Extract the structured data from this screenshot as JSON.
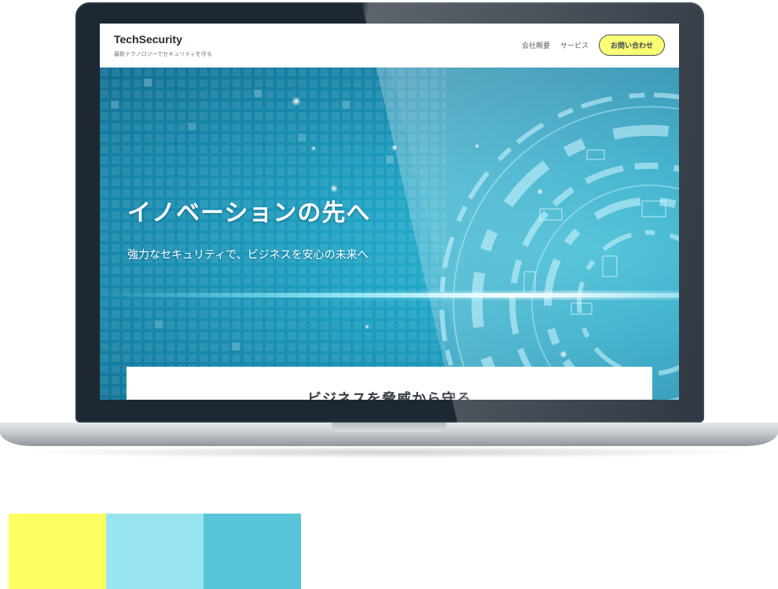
{
  "site": {
    "logo": "TechSecurity",
    "tagline": "最新テクノロジーでセキュリティを守る",
    "nav": [
      {
        "label": "会社概要"
      },
      {
        "label": "サービス"
      }
    ],
    "cta_label": "お問い合わせ"
  },
  "hero": {
    "title": "イノベーションの先へ",
    "subtitle": "強力なセキュリティで、ビジネスを安心の未来へ"
  },
  "section": {
    "heading": "ビジネスを脅威から守る"
  },
  "palette": [
    {
      "color": "#fdfe60"
    },
    {
      "color": "#98e4f0"
    },
    {
      "color": "#58c5d8"
    }
  ],
  "colors": {
    "accent": "#f8ff5c",
    "hero_primary": "#1fa3c4",
    "bezel": "#1e2832"
  }
}
